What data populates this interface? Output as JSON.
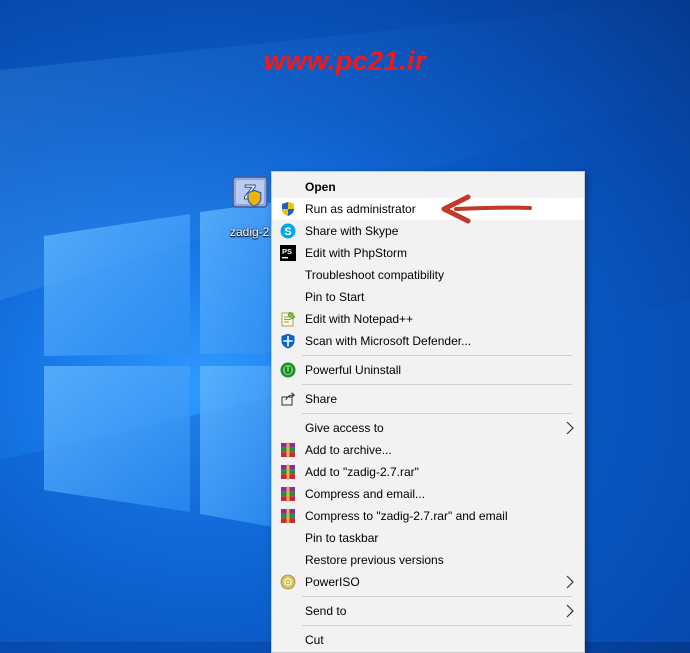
{
  "watermark": "www.pc21.ir",
  "desktop": {
    "file_icon_label": "zadig-2."
  },
  "context_menu": {
    "items": [
      {
        "label": "Open",
        "icon": "none",
        "bold": true
      },
      {
        "label": "Run as administrator",
        "icon": "uac-shield-icon"
      },
      {
        "label": "Share with Skype",
        "icon": "skype-icon"
      },
      {
        "label": "Edit with PhpStorm",
        "icon": "phpstorm-icon"
      },
      {
        "label": "Troubleshoot compatibility",
        "icon": "none"
      },
      {
        "label": "Pin to Start",
        "icon": "none"
      },
      {
        "label": "Edit with Notepad++",
        "icon": "notepadplusplus-icon"
      },
      {
        "label": "Scan with Microsoft Defender...",
        "icon": "defender-icon"
      },
      {
        "label": "Powerful Uninstall",
        "icon": "uninstaller-icon"
      },
      {
        "label": "Share",
        "icon": "share-icon"
      },
      {
        "label": "Give access to",
        "icon": "none",
        "submenu": true
      },
      {
        "label": "Add to archive...",
        "icon": "winrar-icon"
      },
      {
        "label": "Add to \"zadig-2.7.rar\"",
        "icon": "winrar-icon"
      },
      {
        "label": "Compress and email...",
        "icon": "winrar-icon"
      },
      {
        "label": "Compress to \"zadig-2.7.rar\" and email",
        "icon": "winrar-icon"
      },
      {
        "label": "Pin to taskbar",
        "icon": "none"
      },
      {
        "label": "Restore previous versions",
        "icon": "none"
      },
      {
        "label": "PowerISO",
        "icon": "poweriso-icon",
        "submenu": true
      },
      {
        "label": "Send to",
        "icon": "none",
        "submenu": true
      },
      {
        "label": "Cut",
        "icon": "none"
      }
    ]
  },
  "colors": {
    "watermark": "#ff1414",
    "annotation_arrow": "#c0392b",
    "menu_background": "#f2f2f2",
    "menu_highlight": "#ffffff"
  }
}
